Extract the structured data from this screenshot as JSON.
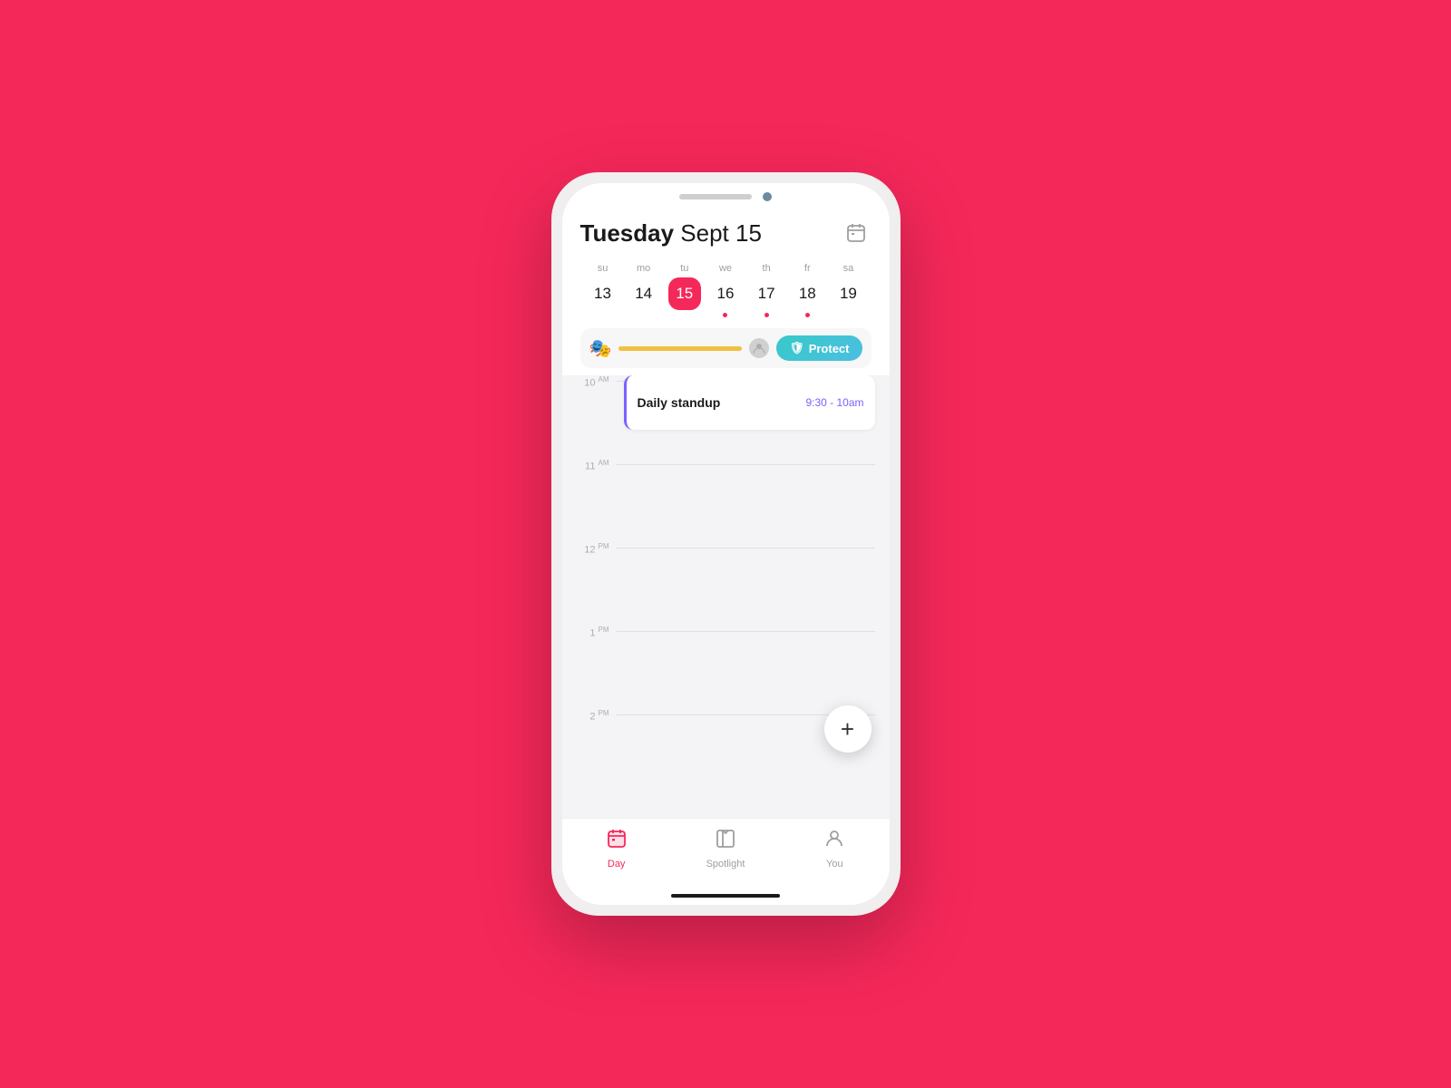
{
  "background": "#F5285A",
  "phone": {
    "notch": {
      "pill_color": "#D0CECE",
      "camera_color": "#6B8CA0"
    },
    "header": {
      "title_bold": "Tuesday",
      "title_regular": " Sept 15",
      "calendar_icon": "calendar-icon"
    },
    "week": {
      "days": [
        {
          "label": "su",
          "number": "13",
          "active": false,
          "dot": false
        },
        {
          "label": "mo",
          "number": "14",
          "active": false,
          "dot": false
        },
        {
          "label": "tu",
          "number": "15",
          "active": true,
          "dot": false
        },
        {
          "label": "we",
          "number": "16",
          "active": false,
          "dot": true
        },
        {
          "label": "th",
          "number": "17",
          "active": false,
          "dot": true
        },
        {
          "label": "fr",
          "number": "18",
          "active": false,
          "dot": true
        },
        {
          "label": "sa",
          "number": "19",
          "active": false,
          "dot": false
        }
      ]
    },
    "banner": {
      "icon": "🎭",
      "protect_label": "Protect",
      "protect_icon": "🛡"
    },
    "time_slots": [
      {
        "hour": "10",
        "suffix": "AM",
        "has_event": true
      },
      {
        "hour": "11",
        "suffix": "AM",
        "has_event": false
      },
      {
        "hour": "12",
        "suffix": "PM",
        "has_event": false
      },
      {
        "hour": "1",
        "suffix": "PM",
        "has_event": false
      },
      {
        "hour": "2",
        "suffix": "PM",
        "has_event": false
      }
    ],
    "event": {
      "title": "Daily standup",
      "time": "9:30 - 10am",
      "color": "#7B61FF"
    },
    "fab": {
      "label": "+"
    },
    "bottom_nav": {
      "items": [
        {
          "id": "day",
          "label": "Day",
          "icon": "📅",
          "active": true
        },
        {
          "id": "spotlight",
          "label": "Spotlight",
          "icon": "🔖",
          "active": false
        },
        {
          "id": "you",
          "label": "You",
          "icon": "👤",
          "active": false
        }
      ]
    },
    "home_indicator_color": "#1a1a1a"
  }
}
